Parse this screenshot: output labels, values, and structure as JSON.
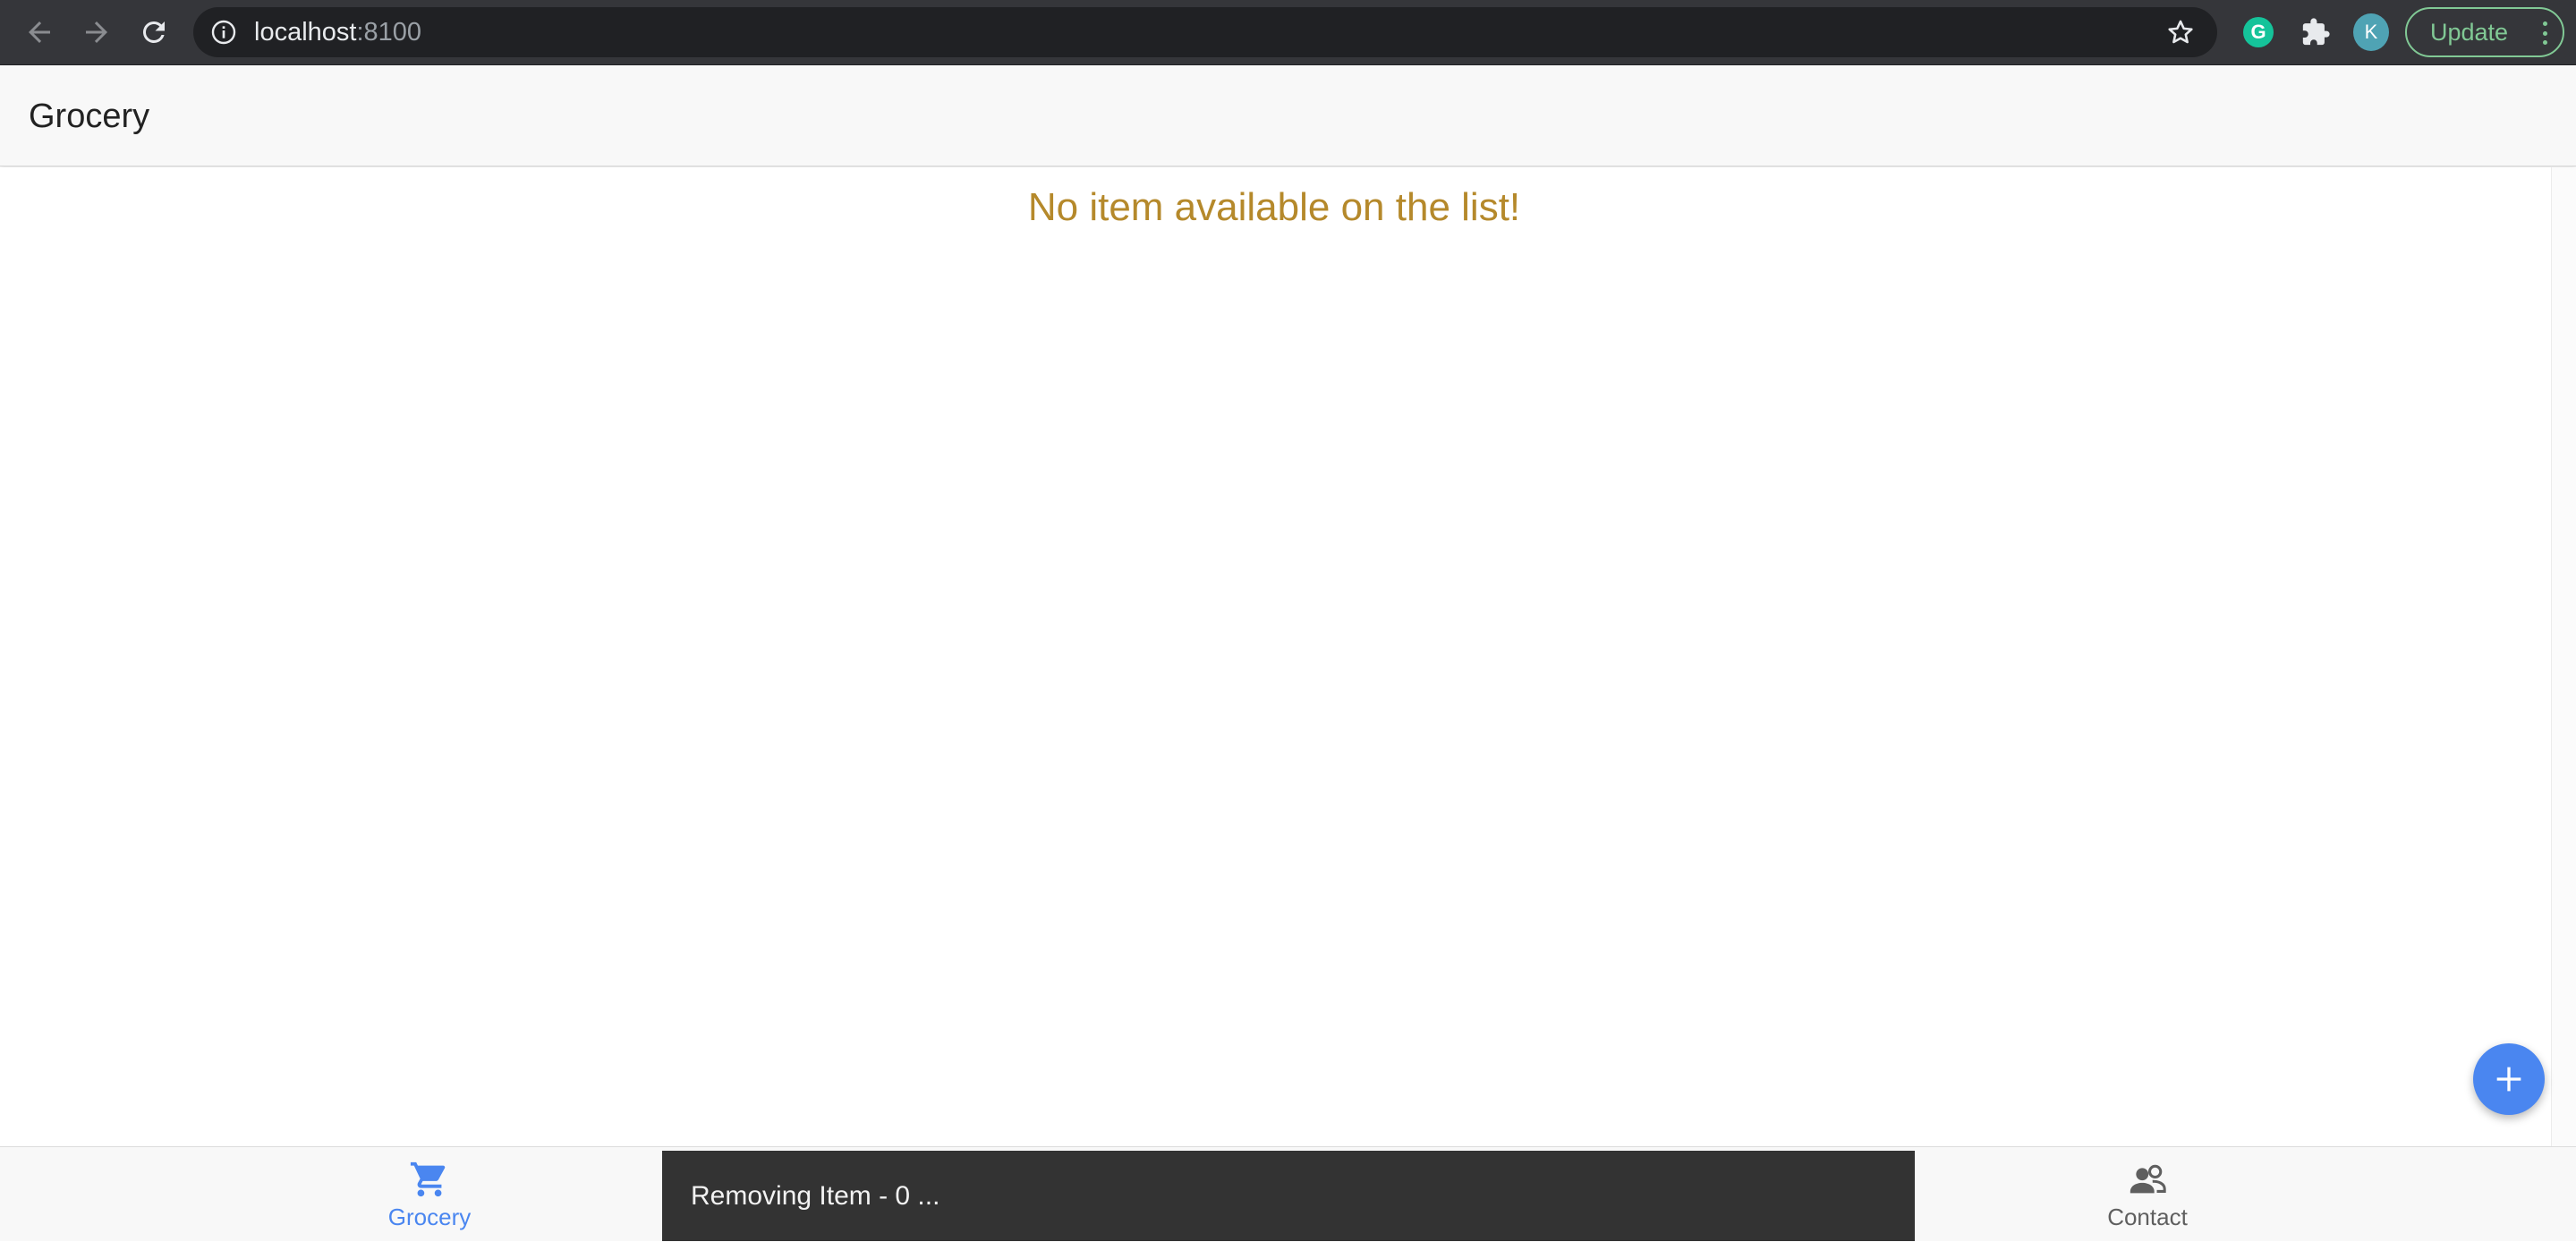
{
  "browser": {
    "url_host": "localhost",
    "url_port": ":8100",
    "profile_initial": "K",
    "extension_initial": "G",
    "update_label": "Update",
    "icons": [
      "back-arrow-icon",
      "forward-arrow-icon",
      "reload-icon",
      "info-icon",
      "star-icon",
      "grammarly-icon",
      "puzzle-icon",
      "more-vert-icon"
    ]
  },
  "header": {
    "title": "Grocery"
  },
  "main": {
    "empty_message": "No item available on the list!",
    "empty_message_color": "#b5892b",
    "fab_icon": "add-icon"
  },
  "tabs": [
    {
      "label": "Grocery",
      "icon": "cart-icon",
      "selected": true
    },
    {
      "label": "Contact",
      "icon": "people-icon",
      "selected": false
    }
  ],
  "toast": {
    "message": "Removing Item - 0 ..."
  },
  "colors": {
    "accent": "#4a86f0",
    "toast_bg": "#333333",
    "update_green": "#81c995"
  }
}
